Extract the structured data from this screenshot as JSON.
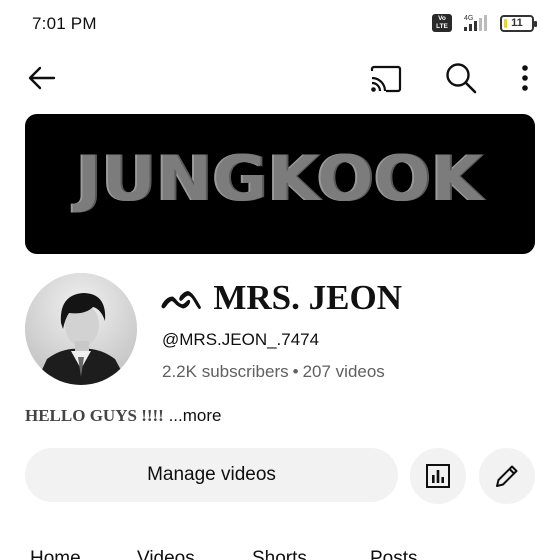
{
  "status_bar": {
    "time": "7:01 PM",
    "volte_label": "Vo LTE",
    "network_label": "4G",
    "battery_level": "11",
    "battery_fraction": 0.11
  },
  "top_bar": {
    "icons": [
      "back-arrow-icon",
      "cast-icon",
      "search-icon",
      "more-vert-icon"
    ]
  },
  "banner": {
    "text": "JUNGKOOK"
  },
  "channel": {
    "name": "ᨒ MRS. JEON",
    "handle": "@MRS.JEON_.7474",
    "subscribers": "2.2K subscribers",
    "separator": "•",
    "videos": "207 videos",
    "description": "HELLO GUYS !!!!",
    "more_label": "...more"
  },
  "actions": {
    "manage_label": "Manage videos",
    "analytics_icon": "bar-chart-icon",
    "edit_icon": "pencil-icon"
  },
  "tabs": [
    {
      "label": "Home"
    },
    {
      "label": "Videos"
    },
    {
      "label": "Shorts"
    },
    {
      "label": "Posts"
    }
  ],
  "colors": {
    "secondary_text": "#606060",
    "button_bg": "#f2f2f2",
    "banner_bg": "#000000"
  }
}
